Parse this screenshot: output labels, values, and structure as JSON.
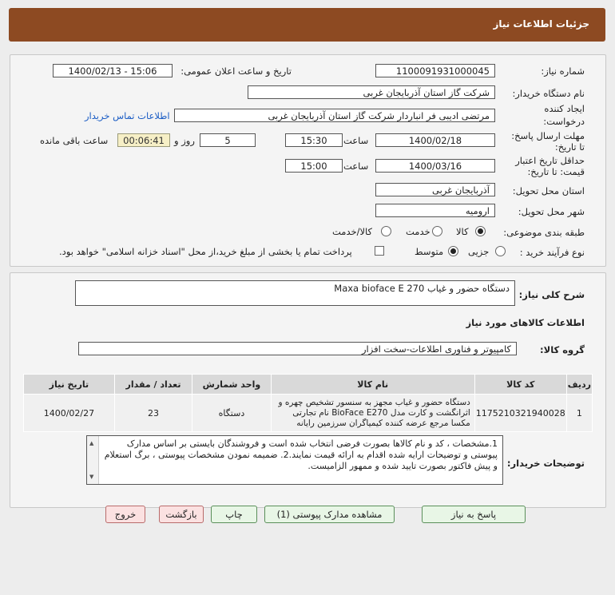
{
  "header": {
    "title": "جزئیات اطلاعات نیاز"
  },
  "form": {
    "need_number_label": "شماره نیاز:",
    "need_number": "1100091931000045",
    "announce_label": "تاریخ و ساعت اعلان عمومی:",
    "announce_value": "1400/02/13 - 15:06",
    "buyer_org_label": "نام دستگاه خریدار:",
    "buyer_org": "شرکت گاز استان آذربایجان غربی",
    "creator_label": "ایجاد کننده درخواست:",
    "creator": "مرتضی ادیبی فر انباردار شرکت گاز استان آذربایجان غربی",
    "contact_link": "اطلاعات تماس خریدار",
    "reply_deadline_label": "مهلت ارسال پاسخ: تا تاریخ:",
    "reply_date": "1400/02/18",
    "time_label": "ساعت",
    "reply_time": "15:30",
    "days_value": "5",
    "days_label": "روز و",
    "timer": "00:06:41",
    "remaining_label": "ساعت باقی مانده",
    "validity_label": "حداقل تاریخ اعتبار قیمت: تا تاریخ:",
    "validity_date": "1400/03/16",
    "validity_time_label": "ساعت",
    "validity_time": "15:00",
    "province_label": "استان محل تحویل:",
    "province": "آذربایجان غربی",
    "city_label": "شهر محل تحویل:",
    "city": "ارومیه",
    "category_label": "طبقه بندی موضوعی:",
    "category_options": [
      "کالا",
      "خدمت",
      "کالا/خدمت"
    ],
    "process_label": "نوع فرآیند خرید :",
    "process_options": [
      "جزیی",
      "متوسط"
    ],
    "payment_text": "پرداخت تمام یا بخشی از مبلغ خرید،از محل \"اسناد خزانه اسلامی\" خواهد بود."
  },
  "summary": {
    "desc_label": "شرح کلی نیاز:",
    "desc_value": "دستگاه حضور و غیاب Maxa bioface E 270",
    "goods_info_title": "اطلاعات کالاهای مورد نیاز",
    "group_label": "گروه کالا:",
    "group_value": "کامپیوتر و فناوری اطلاعات-سخت افزار"
  },
  "table": {
    "headers": [
      "ردیف",
      "کد کالا",
      "نام کالا",
      "واحد شمارش",
      "تعداد / مقدار",
      "تاریخ نیاز"
    ],
    "rows": [
      {
        "row": "1",
        "code": "1175210321940028",
        "name": "دستگاه حضور و غیاب مجهز به سنسور تشخیص چهره و اثرانگشت و کارت مدل BioFace E270 نام تجارتی مکسا مرجع عرضه کننده کیمیاگران سرزمین رایانه",
        "unit": "دستگاه",
        "qty": "23",
        "date": "1400/02/27"
      }
    ]
  },
  "notes": {
    "label": "توضیحات خریدار:",
    "text": "1.مشخصات ، کد و نام کالاها بصورت فرضی انتخاب شده است و فروشندگان بایستی بر اساس مدارک پیوستی و توضیحات ارایه شده اقدام به ارائه قیمت نمایند.2. ضمیمه نمودن مشخصات پیوستی ، برگ استعلام و پیش فاکتور بصورت تایید شده و ممهور الزامیست."
  },
  "buttons": {
    "reply": "پاسخ به نیاز",
    "attachments": "مشاهده مدارک پیوستی (1)",
    "print": "چاپ",
    "back": "بازگشت",
    "exit": "خروج"
  }
}
